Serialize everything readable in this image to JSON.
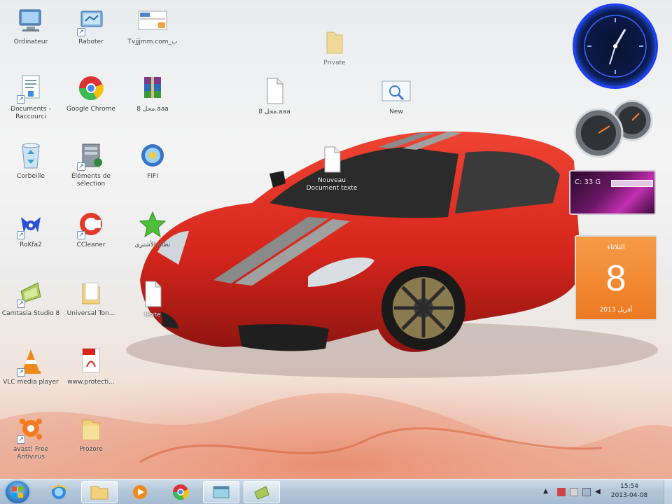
{
  "desktop": {
    "icons_col1": [
      {
        "name": "computer",
        "label": "Ordinateur"
      },
      {
        "name": "documents",
        "label": "Documents - Raccourci"
      },
      {
        "name": "recycle-bin",
        "label": "Corbeille"
      },
      {
        "name": "rokfa",
        "label": "RoKfa2"
      },
      {
        "name": "camtasia",
        "label": "Camtasia Studio 8"
      },
      {
        "name": "vlc",
        "label": "VLC media player"
      },
      {
        "name": "avast",
        "label": "avast! Free Antivirus"
      }
    ],
    "icons_col2": [
      {
        "name": "network",
        "label": "Raboter"
      },
      {
        "name": "chrome",
        "label": "Google Chrome"
      },
      {
        "name": "control-panel",
        "label": "Éléments de sélection"
      },
      {
        "name": "ccleaner",
        "label": "CCleaner"
      },
      {
        "name": "folder",
        "label": "Universal Ton..."
      },
      {
        "name": "pdf",
        "label": "www.protecti..."
      },
      {
        "name": "folder2",
        "label": "Prozore"
      }
    ],
    "icons_col3": [
      {
        "name": "web-shortcut",
        "label": "Tvjjjmm.com_ب"
      },
      {
        "name": "winrar",
        "label": "محل 8.aaa"
      },
      {
        "name": "app-globe",
        "label": "FIFI"
      },
      {
        "name": "star-app",
        "label": "نظام الأشترى"
      }
    ],
    "icons_free": [
      {
        "name": "folder-drag",
        "label": "Private"
      },
      {
        "name": "text-file",
        "label": "محل 8.aaa"
      },
      {
        "name": "image-file",
        "label": "New"
      },
      {
        "name": "new-text-doc",
        "label": "Nouveau Document texte"
      },
      {
        "name": "blank-file",
        "label": "texte"
      }
    ]
  },
  "gadgets": {
    "cpu_text": "C: 33 G",
    "calendar_day_name": "الثلاثاء",
    "calendar_day": "8",
    "calendar_month_year": "أفريل 2013"
  },
  "taskbar": {
    "clock_time": "15:54",
    "clock_date": "2013-04-08"
  },
  "colors": {
    "taskbar": "#b3c7d9",
    "calendar": "#ec7a22",
    "car": "#d5261c"
  }
}
